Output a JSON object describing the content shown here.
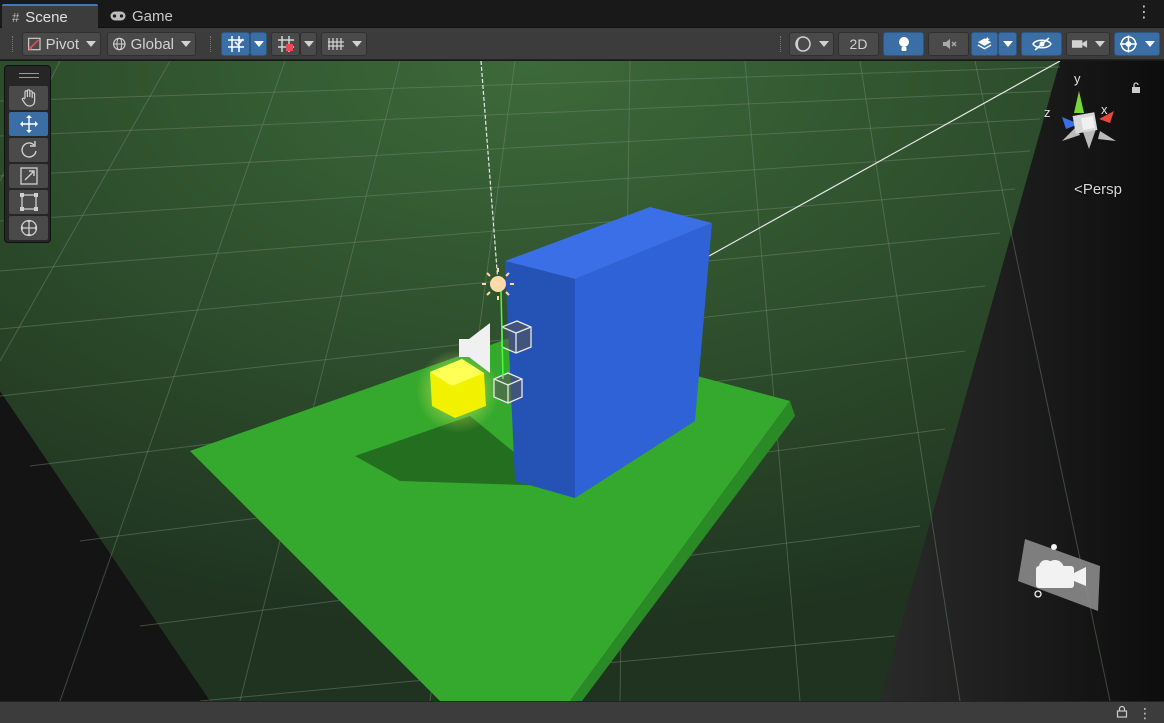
{
  "tabs": [
    {
      "label": "Scene",
      "icon": "grid-hash-icon",
      "active": true
    },
    {
      "label": "Game",
      "icon": "gamepad-icon",
      "active": false
    }
  ],
  "toolbar": {
    "pivot_label": "Pivot",
    "global_label": "Global",
    "twod_label": "2D"
  },
  "gizmo": {
    "y_label": "y",
    "x_label": "x",
    "z_label": "z",
    "projection_label": "Persp"
  },
  "colors": {
    "accent": "#3a6ea5",
    "ground": "#36a62e",
    "wall": "#2f62d6",
    "light_cube": "#f0f000"
  }
}
